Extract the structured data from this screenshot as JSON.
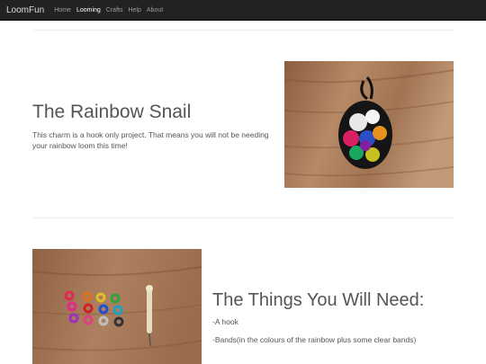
{
  "navbar": {
    "brand": "LoomFun",
    "links": [
      {
        "label": "Home",
        "active": false
      },
      {
        "label": "Looming",
        "active": true
      },
      {
        "label": "Crafts",
        "active": false
      },
      {
        "label": "Help",
        "active": false
      },
      {
        "label": "About",
        "active": false
      }
    ]
  },
  "feature1": {
    "title": "The Rainbow Snail",
    "description": "This charm is a hook only project. That means you will not be needing your rainbow loom this time!",
    "image_icon": "rainbow-snail-charm-photo"
  },
  "feature2": {
    "title": "The Things You Will Need:",
    "items": [
      "-A hook",
      "-Bands(in the colours of the rainbow plus some clear bands)"
    ],
    "image_icon": "bands-and-hook-photo"
  },
  "colors": {
    "navbar_bg": "#222222",
    "nav_active": "#ffffff",
    "nav_inactive": "#9d9d9d",
    "heading": "#555555",
    "wood": "#a87a57"
  }
}
